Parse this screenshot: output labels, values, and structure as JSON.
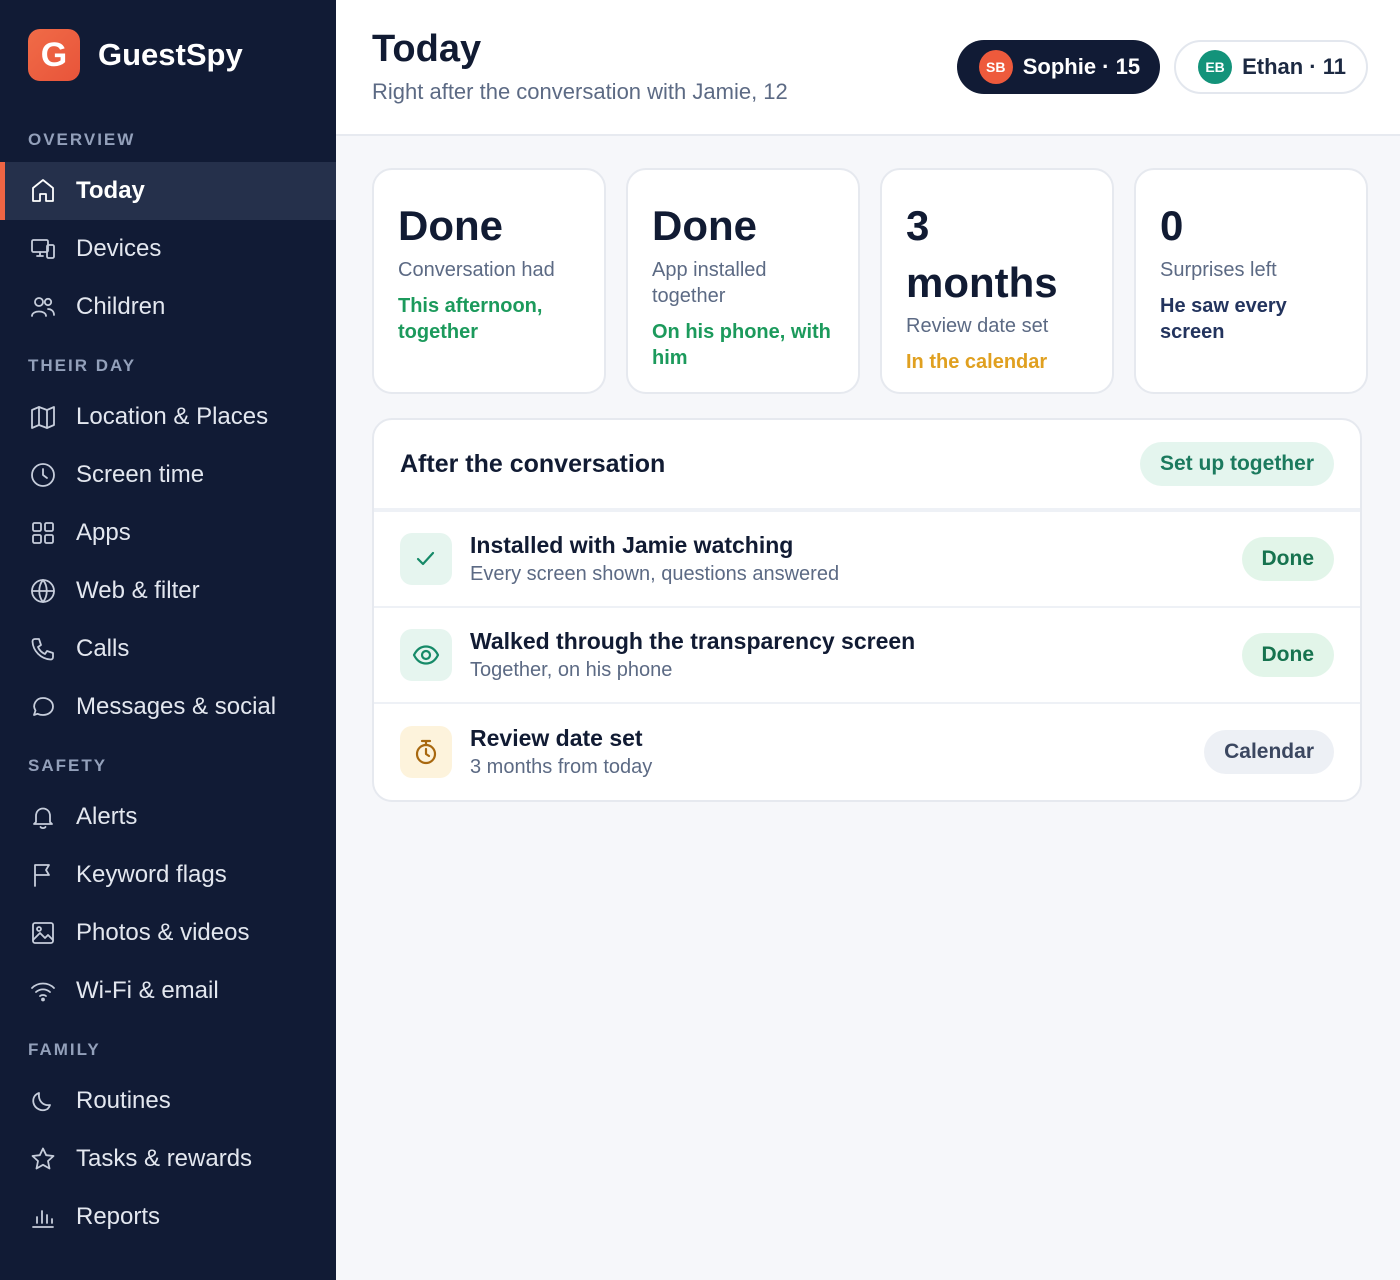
{
  "app": {
    "logo_letter": "G",
    "name": "GuestSpy"
  },
  "sidebar": {
    "sections": [
      {
        "label": "OVERVIEW",
        "items": [
          {
            "label": "Today",
            "icon": "home-icon",
            "active": true
          },
          {
            "label": "Devices",
            "icon": "devices-icon"
          },
          {
            "label": "Children",
            "icon": "users-icon"
          }
        ]
      },
      {
        "label": "THEIR DAY",
        "items": [
          {
            "label": "Location & Places",
            "icon": "map-icon"
          },
          {
            "label": "Screen time",
            "icon": "clock-icon"
          },
          {
            "label": "Apps",
            "icon": "grid-icon"
          },
          {
            "label": "Web & filter",
            "icon": "globe-icon"
          },
          {
            "label": "Calls",
            "icon": "phone-icon"
          },
          {
            "label": "Messages & social",
            "icon": "chat-icon"
          }
        ]
      },
      {
        "label": "SAFETY",
        "items": [
          {
            "label": "Alerts",
            "icon": "bell-icon"
          },
          {
            "label": "Keyword flags",
            "icon": "flag-icon"
          },
          {
            "label": "Photos & videos",
            "icon": "image-icon"
          },
          {
            "label": "Wi-Fi & email",
            "icon": "wifi-icon"
          }
        ]
      },
      {
        "label": "FAMILY",
        "items": [
          {
            "label": "Routines",
            "icon": "moon-icon"
          },
          {
            "label": "Tasks & rewards",
            "icon": "star-icon"
          },
          {
            "label": "Reports",
            "icon": "bar-chart-icon"
          }
        ]
      }
    ]
  },
  "header": {
    "title": "Today",
    "subtitle": "Right after the conversation with Jamie, 12",
    "profiles": [
      {
        "initials": "SB",
        "label": "Sophie · 15",
        "avatar_color": "#ee5a3c",
        "active": true
      },
      {
        "initials": "EB",
        "label": "Ethan · 11",
        "avatar_color": "#13937a",
        "active": false
      }
    ]
  },
  "stats": [
    {
      "value": "Done",
      "label": "Conversation had",
      "note": "This afternoon, together",
      "note_color": "#1c9a5c"
    },
    {
      "value": "Done",
      "label": "App installed together",
      "note": "On his phone, with him",
      "note_color": "#1c9a5c"
    },
    {
      "value": "3 months",
      "label": "Review date set",
      "note": "In the calendar",
      "note_color": "#e0a020"
    },
    {
      "value": "0",
      "label": "Surprises left",
      "note": "He saw every screen",
      "note_color": "#23345e"
    }
  ],
  "panel": {
    "title": "After the conversation",
    "action_label": "Set up together",
    "rows": [
      {
        "icon": "check-icon",
        "icon_bg": "#e6f5ef",
        "icon_color": "#168a68",
        "title": "Installed with Jamie watching",
        "subtitle": "Every screen shown, questions answered",
        "status": "Done",
        "status_kind": "done"
      },
      {
        "icon": "eye-icon",
        "icon_bg": "#e6f5ef",
        "icon_color": "#168a68",
        "title": "Walked through the transparency screen",
        "subtitle": "Together, on his phone",
        "status": "Done",
        "status_kind": "done"
      },
      {
        "icon": "timer-icon",
        "icon_bg": "#fdf3dc",
        "icon_color": "#a8680f",
        "title": "Review date set",
        "subtitle": "3 months from today",
        "status": "Calendar",
        "status_kind": "neutral"
      }
    ]
  }
}
